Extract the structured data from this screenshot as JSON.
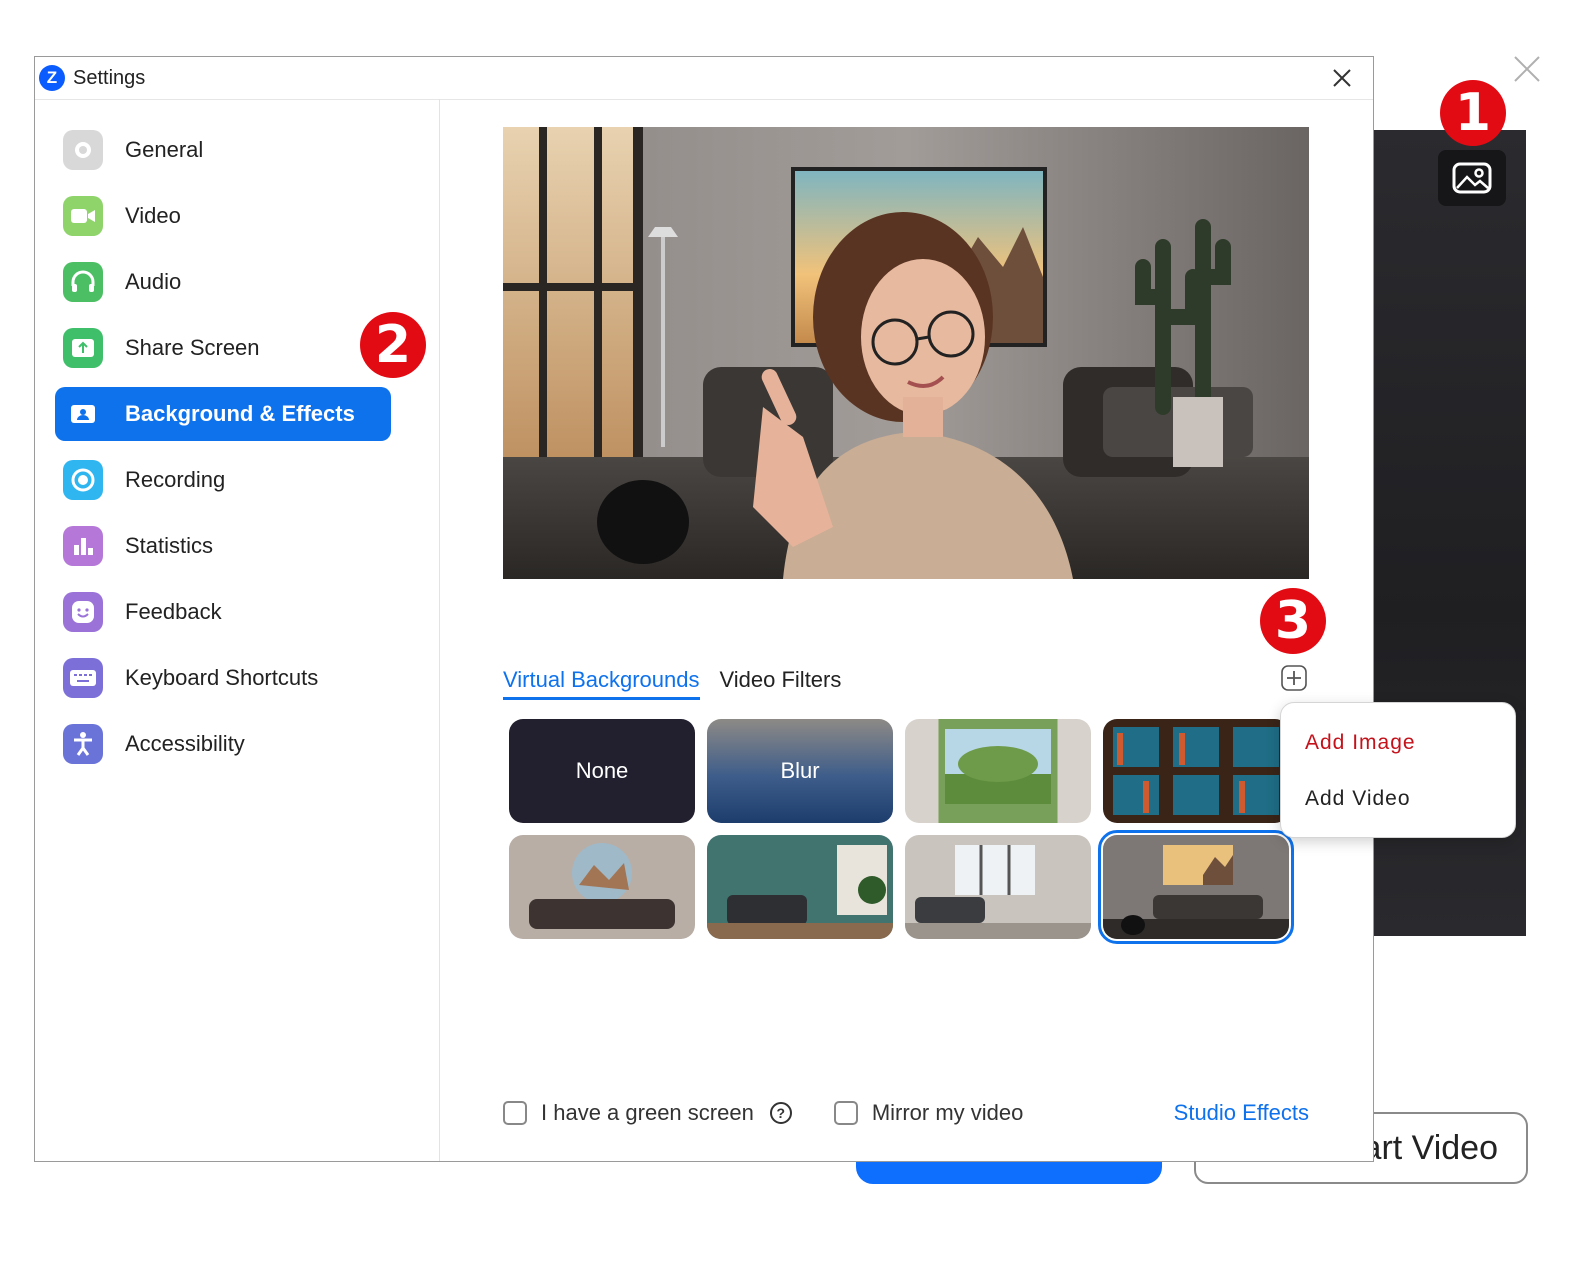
{
  "window": {
    "title": "Settings"
  },
  "sidebar": {
    "items": [
      {
        "label": "General",
        "icon": "gear-icon",
        "color": "#d5d5d5"
      },
      {
        "label": "Video",
        "icon": "video-camera-icon",
        "color": "#8ed46a"
      },
      {
        "label": "Audio",
        "icon": "headphones-icon",
        "color": "#4cbf64"
      },
      {
        "label": "Share Screen",
        "icon": "share-screen-icon",
        "color": "#3fbf6a"
      },
      {
        "label": "Background & Effects",
        "icon": "background-effects-icon",
        "color": "#0e72ed"
      },
      {
        "label": "Recording",
        "icon": "recording-icon",
        "color": "#2fb5f0"
      },
      {
        "label": "Statistics",
        "icon": "statistics-icon",
        "color": "#b678d8"
      },
      {
        "label": "Feedback",
        "icon": "feedback-smile-icon",
        "color": "#9b73d8"
      },
      {
        "label": "Keyboard Shortcuts",
        "icon": "keyboard-icon",
        "color": "#7d6fd8"
      },
      {
        "label": "Accessibility",
        "icon": "accessibility-icon",
        "color": "#6a73d8"
      }
    ],
    "active_index": 4
  },
  "main": {
    "tabs": [
      {
        "label": "Virtual Backgrounds",
        "active": true
      },
      {
        "label": "Video Filters",
        "active": false
      }
    ],
    "backgrounds": [
      {
        "label": "None"
      },
      {
        "label": "Blur"
      },
      {
        "label": ""
      },
      {
        "label": ""
      },
      {
        "label": ""
      },
      {
        "label": ""
      },
      {
        "label": ""
      },
      {
        "label": "",
        "selected": true
      }
    ],
    "green_screen_label": "I have a green screen",
    "mirror_label": "Mirror my video",
    "studio_effects_label": "Studio Effects"
  },
  "popup": {
    "add_image": "Add  Image",
    "add_video": "Add  Video"
  },
  "behind": {
    "video_button_label": "Start Video"
  },
  "annotations": [
    "1",
    "2",
    "3"
  ],
  "colors": {
    "accent": "#0e72ed",
    "badge": "#e30b13",
    "popup_red": "#c4121b"
  }
}
